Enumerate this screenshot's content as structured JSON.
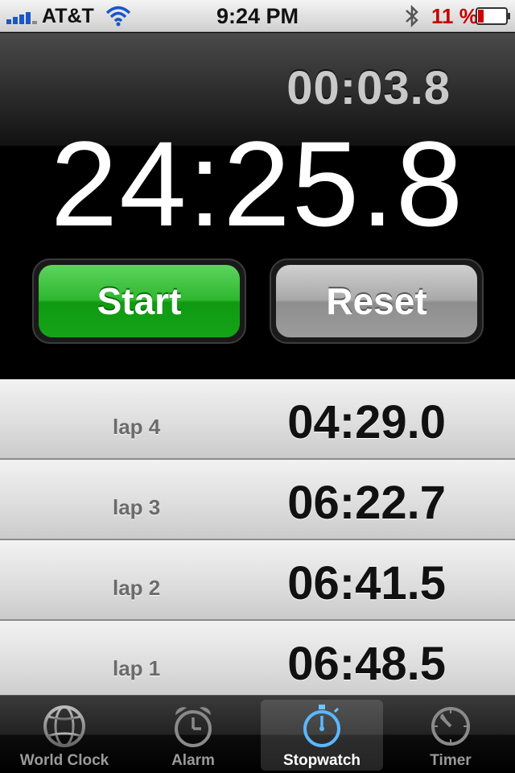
{
  "status_bar": {
    "carrier": "AT&T",
    "time": "9:24 PM",
    "battery_percent": "11 %",
    "battery_color": "#c40000",
    "icons": [
      "signal-bars-icon",
      "wifi-icon",
      "bluetooth-icon",
      "battery-icon"
    ]
  },
  "stopwatch": {
    "lap_time": "00:03.8",
    "total_time": "24:25.8",
    "start_label": "Start",
    "reset_label": "Reset",
    "start_color": "#1fae1f"
  },
  "laps": [
    {
      "label": "lap 4",
      "time": "04:29.0"
    },
    {
      "label": "lap 3",
      "time": "06:22.7"
    },
    {
      "label": "lap 2",
      "time": "06:41.5"
    },
    {
      "label": "lap 1",
      "time": "06:48.5"
    }
  ],
  "tabs": [
    {
      "label": "World Clock",
      "icon": "globe-icon",
      "selected": false
    },
    {
      "label": "Alarm",
      "icon": "alarm-clock-icon",
      "selected": false
    },
    {
      "label": "Stopwatch",
      "icon": "stopwatch-icon",
      "selected": true
    },
    {
      "label": "Timer",
      "icon": "timer-icon",
      "selected": false
    }
  ]
}
